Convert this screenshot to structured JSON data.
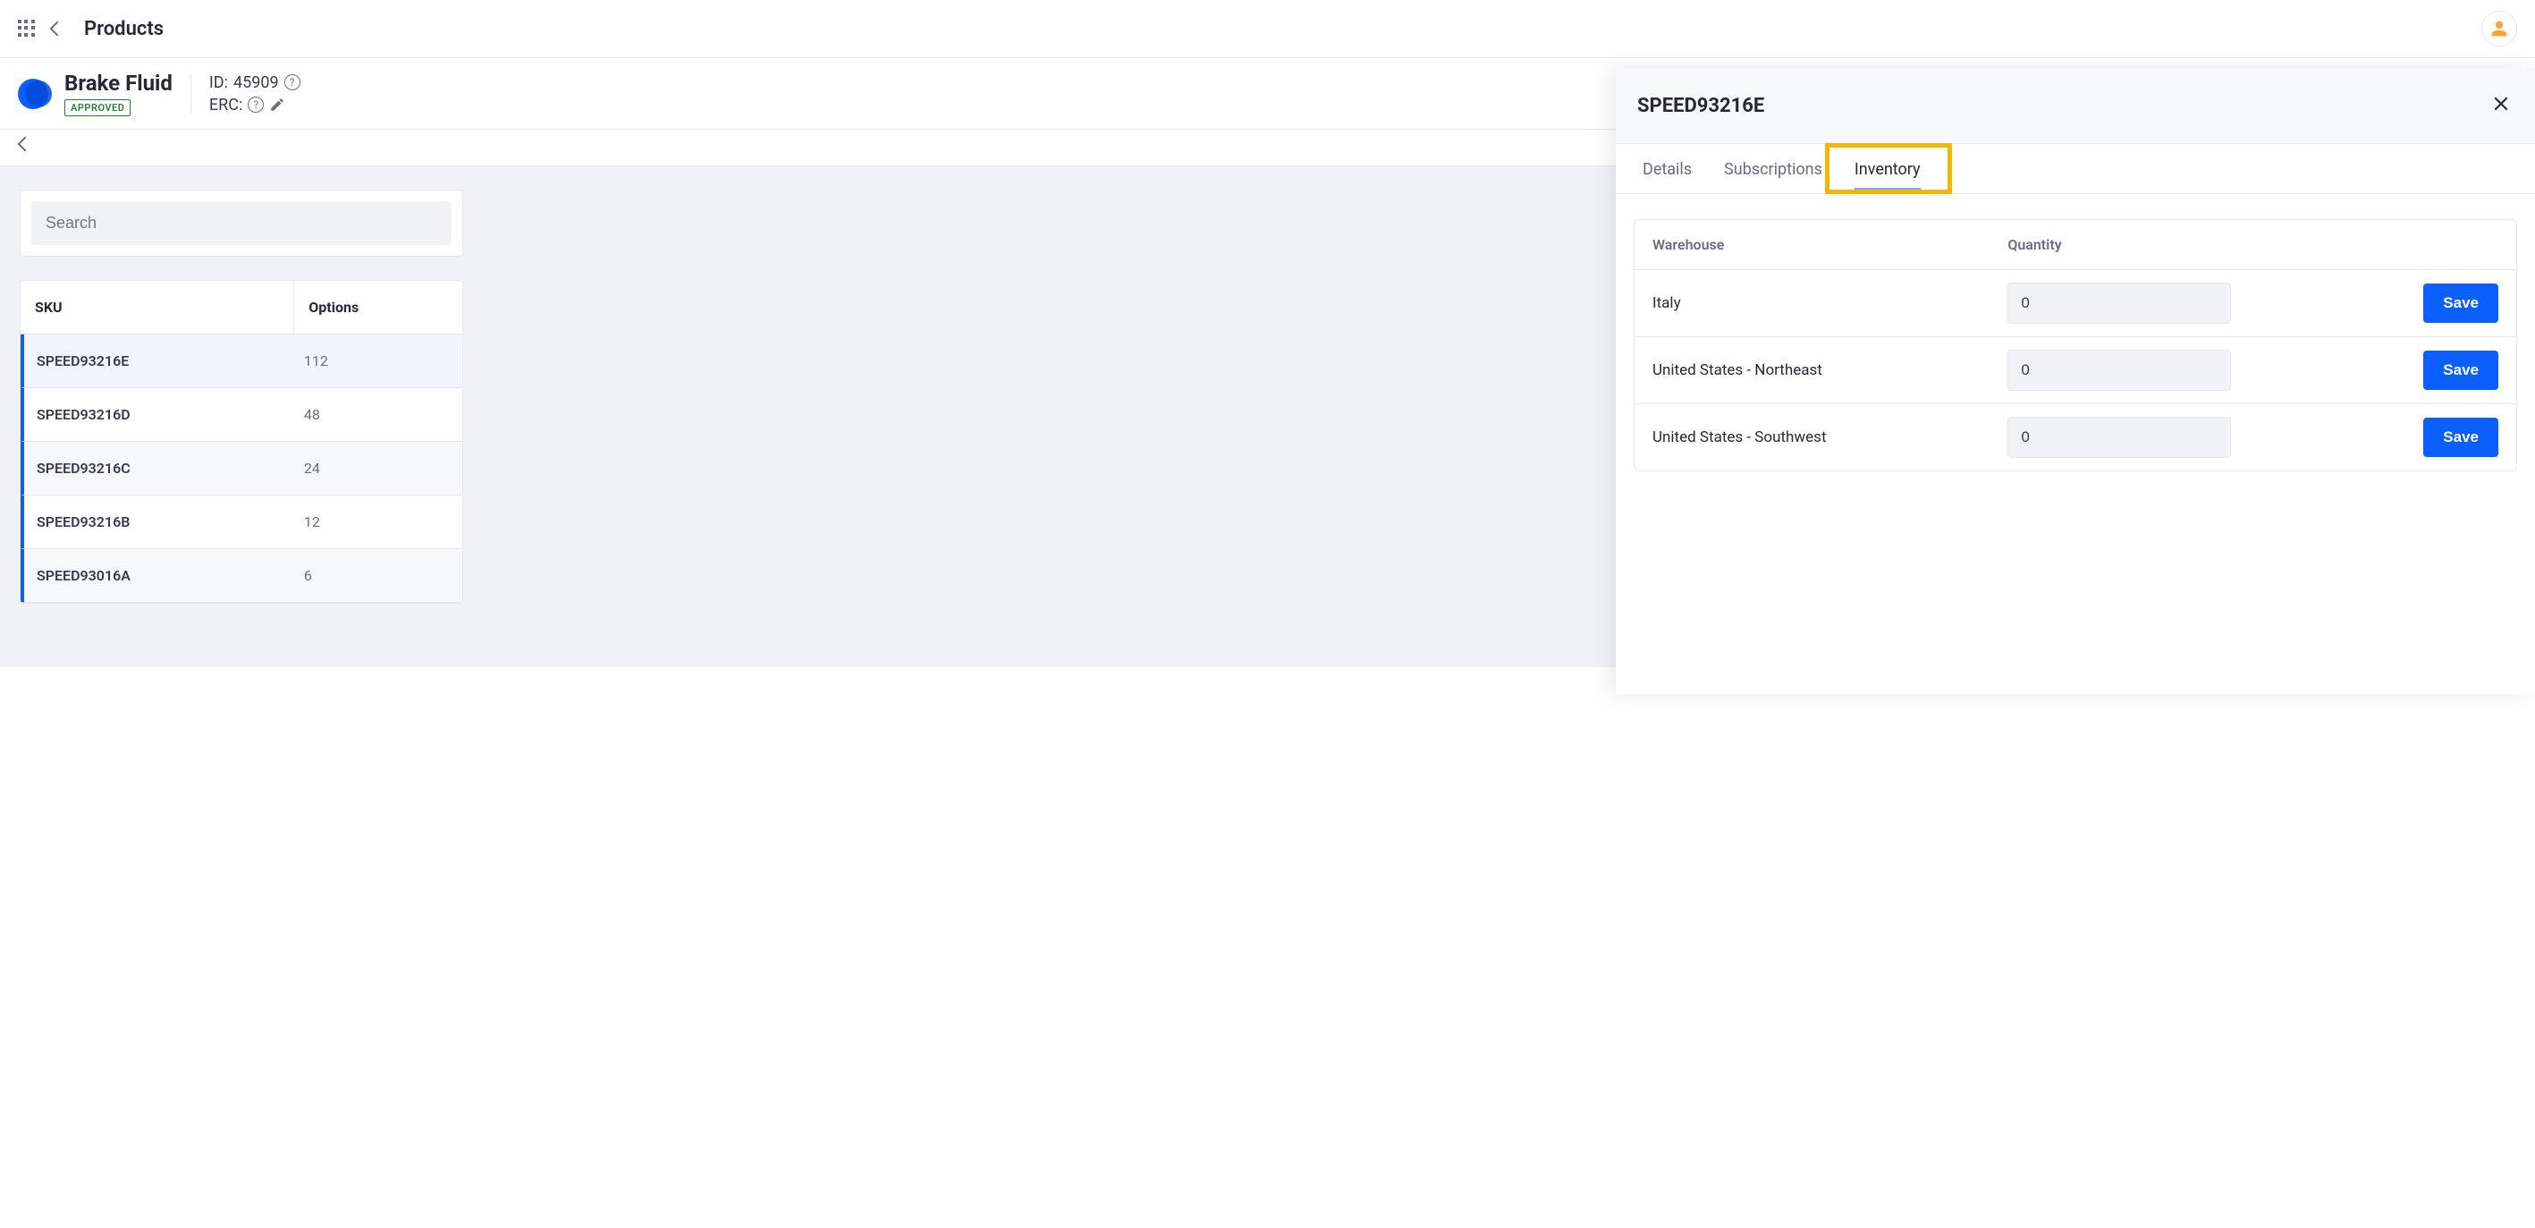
{
  "topbar": {
    "title": "Products"
  },
  "product": {
    "name": "Brake Fluid",
    "status": "APPROVED",
    "id_label": "ID:",
    "id_value": "45909",
    "erc_label": "ERC:"
  },
  "search": {
    "placeholder": "Search"
  },
  "sku_table": {
    "headers": {
      "sku": "SKU",
      "options": "Options"
    },
    "rows": [
      {
        "sku": "SPEED93216E",
        "options": "112"
      },
      {
        "sku": "SPEED93216D",
        "options": "48"
      },
      {
        "sku": "SPEED93216C",
        "options": "24"
      },
      {
        "sku": "SPEED93216B",
        "options": "12"
      },
      {
        "sku": "SPEED93016A",
        "options": "6"
      }
    ]
  },
  "panel": {
    "title": "SPEED93216E",
    "tabs": [
      {
        "label": "Details",
        "active": false
      },
      {
        "label": "Subscriptions",
        "active": false
      },
      {
        "label": "Inventory",
        "active": true
      }
    ],
    "inventory": {
      "headers": {
        "warehouse": "Warehouse",
        "quantity": "Quantity"
      },
      "save_label": "Save",
      "rows": [
        {
          "warehouse": "Italy",
          "quantity": "0"
        },
        {
          "warehouse": "United States - Northeast",
          "quantity": "0"
        },
        {
          "warehouse": "United States - Southwest",
          "quantity": "0"
        }
      ]
    }
  }
}
